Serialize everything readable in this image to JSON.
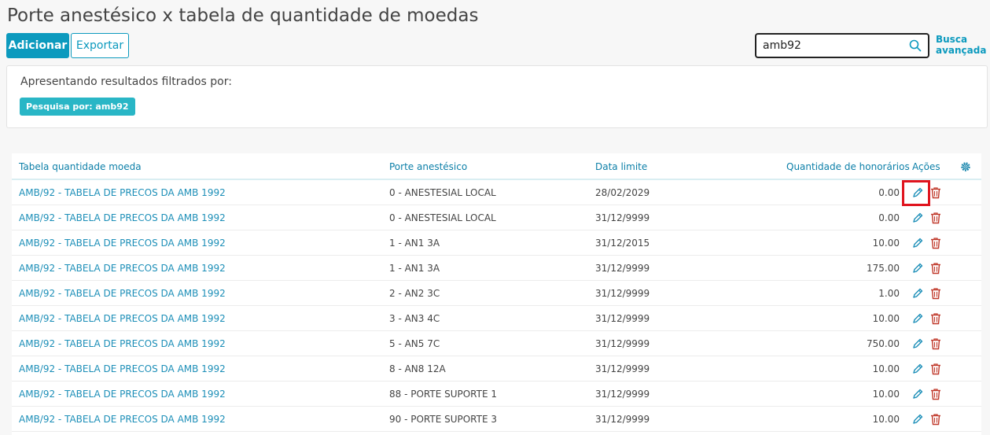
{
  "page": {
    "title": "Porte anestésico x tabela de quantidade de moedas"
  },
  "toolbar": {
    "add_label": "Adicionar",
    "export_label": "Exportar"
  },
  "search": {
    "value": "amb92",
    "advanced_label_line1": "Busca",
    "advanced_label_line2": "avançada"
  },
  "filter": {
    "title": "Apresentando resultados filtrados por:",
    "tag": "Pesquisa por: amb92"
  },
  "table": {
    "headers": {
      "col1": "Tabela quantidade moeda",
      "col2": "Porte anestésico",
      "col3": "Data limite",
      "col4": "Quantidade de honorários",
      "col5": "Ações"
    },
    "rows": [
      {
        "tabela": "AMB/92 - TABELA DE PRECOS DA AMB 1992",
        "porte": "0 - ANESTESIAL LOCAL",
        "data": "28/02/2029",
        "qtd": "0.00"
      },
      {
        "tabela": "AMB/92 - TABELA DE PRECOS DA AMB 1992",
        "porte": "0 - ANESTESIAL LOCAL",
        "data": "31/12/9999",
        "qtd": "0.00"
      },
      {
        "tabela": "AMB/92 - TABELA DE PRECOS DA AMB 1992",
        "porte": "1 - AN1 3A",
        "data": "31/12/2015",
        "qtd": "10.00"
      },
      {
        "tabela": "AMB/92 - TABELA DE PRECOS DA AMB 1992",
        "porte": "1 - AN1 3A",
        "data": "31/12/9999",
        "qtd": "175.00"
      },
      {
        "tabela": "AMB/92 - TABELA DE PRECOS DA AMB 1992",
        "porte": "2 - AN2 3C",
        "data": "31/12/9999",
        "qtd": "1.00"
      },
      {
        "tabela": "AMB/92 - TABELA DE PRECOS DA AMB 1992",
        "porte": "3 - AN3 4C",
        "data": "31/12/9999",
        "qtd": "10.00"
      },
      {
        "tabela": "AMB/92 - TABELA DE PRECOS DA AMB 1992",
        "porte": "5 - AN5 7C",
        "data": "31/12/9999",
        "qtd": "750.00"
      },
      {
        "tabela": "AMB/92 - TABELA DE PRECOS DA AMB 1992",
        "porte": "8 - AN8 12A",
        "data": "31/12/9999",
        "qtd": "10.00"
      },
      {
        "tabela": "AMB/92 - TABELA DE PRECOS DA AMB 1992",
        "porte": "88 - PORTE SUPORTE 1",
        "data": "31/12/9999",
        "qtd": "10.00"
      },
      {
        "tabela": "AMB/92 - TABELA DE PRECOS DA AMB 1992",
        "porte": "90 - PORTE SUPORTE 3",
        "data": "31/12/9999",
        "qtd": "10.00"
      }
    ]
  },
  "colors": {
    "accent": "#0c9abe",
    "tag": "#29b6c6",
    "delete": "#c0392b",
    "highlight": "#e0141e"
  }
}
